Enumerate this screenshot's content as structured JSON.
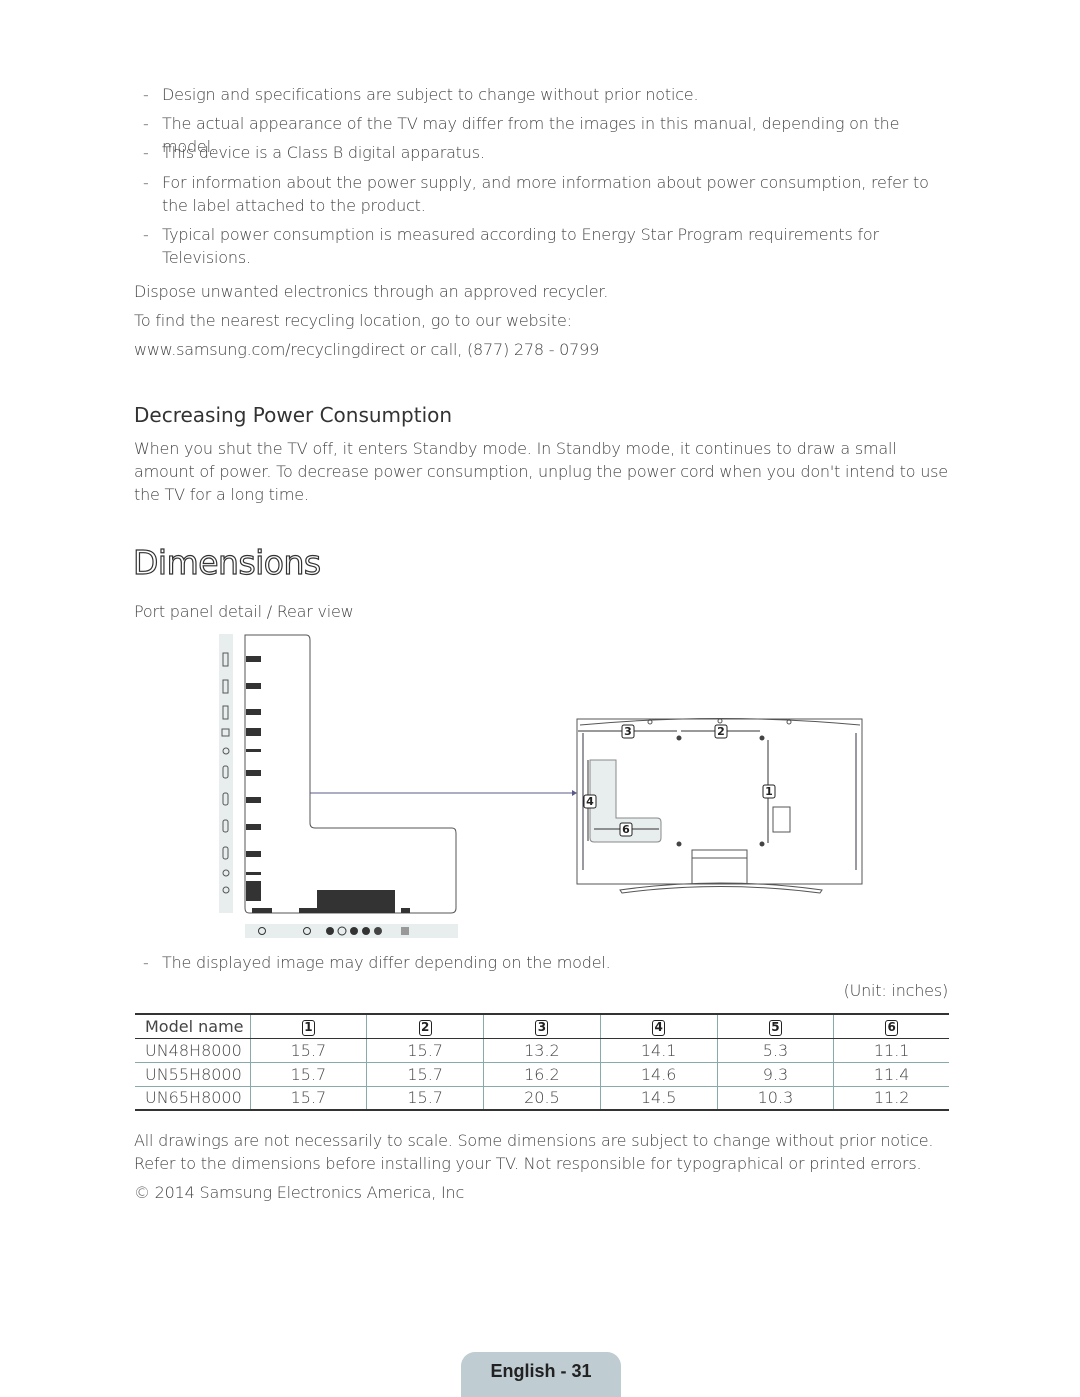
{
  "notes": [
    "Design and specifications are subject to change without prior notice.",
    "The actual appearance of the TV may differ from the images in this manual, depending on the model.",
    "This device is a Class B digital apparatus.",
    "For information about the power supply, and more information about power consumption, refer to the label attached to the product.",
    "Typical power consumption is measured according to Energy Star Program requirements for Televisions."
  ],
  "dash": "-",
  "recycle": [
    "Dispose unwanted electronics through an approved recycler.",
    "To find the nearest recycling location, go to our website:",
    "www.samsung.com/recyclingdirect or call, (877) 278 - 0799"
  ],
  "power": {
    "title": "Decreasing Power Consumption",
    "body": "When you shut the TV off, it enters Standby mode. In Standby mode, it continues to draw a small amount of power. To decrease power consumption, unplug the power cord when you don't intend to use the TV for a long time."
  },
  "dimensions": {
    "title": "Dimensions",
    "caption": "Port panel detail / Rear view",
    "note": "The displayed image may differ depending on the model.",
    "unit": "(Unit: inches)",
    "callouts": {
      "c1": "1",
      "c2": "2",
      "c3": "3",
      "c4": "4",
      "c6": "6"
    },
    "table": {
      "header": [
        "Model name",
        "1",
        "2",
        "3",
        "4",
        "5",
        "6"
      ],
      "rows": [
        [
          "UN48H8000",
          "15.7",
          "15.7",
          "13.2",
          "14.1",
          "5.3",
          "11.1"
        ],
        [
          "UN55H8000",
          "15.7",
          "15.7",
          "16.2",
          "14.6",
          "9.3",
          "11.4"
        ],
        [
          "UN65H8000",
          "15.7",
          "15.7",
          "20.5",
          "14.5",
          "10.3",
          "11.2"
        ]
      ]
    }
  },
  "disclaimer": "All drawings are not necessarily to scale. Some dimensions are subject to change without prior notice. Refer to the dimensions before installing your TV. Not responsible for typographical or printed errors.",
  "copyright": "© 2014 Samsung Electronics America, Inc",
  "footer": "English - 31"
}
